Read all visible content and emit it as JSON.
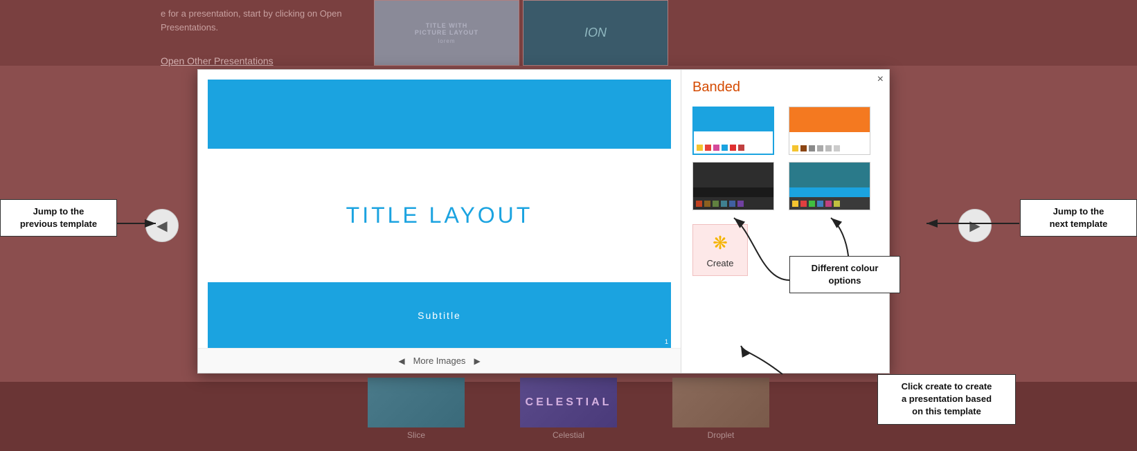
{
  "background": {
    "text_line1": "e for a presentation, start by clicking on Open",
    "text_line2": "Presentations.",
    "open_link": "Open Other Presentations"
  },
  "dialog": {
    "close_label": "×",
    "template_name": "Banded",
    "slide": {
      "title": "TITLE LAYOUT",
      "subtitle": "Subtitle",
      "page_num": "1"
    },
    "more_images_label": "More Images",
    "color_swatches": [
      {
        "id": 1,
        "name": "Blue"
      },
      {
        "id": 2,
        "name": "Orange"
      },
      {
        "id": 3,
        "name": "Dark"
      },
      {
        "id": 4,
        "name": "Teal"
      }
    ],
    "create_button_label": "Create"
  },
  "callouts": {
    "prev": "Jump to the\nprevious template",
    "next": "Jump to the\nnext template",
    "create": "Click create to create\na presentation based\non this template",
    "colors": "Different colour\noptions"
  },
  "template_strip": {
    "items": [
      {
        "name": "Slice",
        "label": "Slice"
      },
      {
        "name": "Celestial",
        "text": "CELESTIAL",
        "label": "Celestial"
      },
      {
        "name": "Droplet",
        "label": "Droplet"
      }
    ]
  },
  "bg_thumbs": {
    "top": [
      {
        "line1": "TITLE WITH",
        "line2": "PICTURE LAYOUT",
        "line3": "lorem"
      },
      {
        "text": "ION"
      }
    ]
  }
}
